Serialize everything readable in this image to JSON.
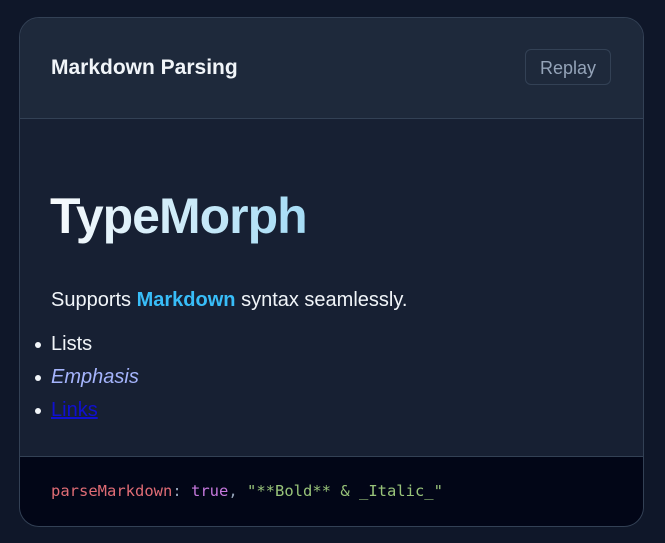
{
  "header": {
    "title": "Markdown Parsing",
    "replay_label": "Replay"
  },
  "preview": {
    "heading": "TypeMorph",
    "paragraph": {
      "before": "Supports ",
      "bold": "Markdown",
      "after": " syntax seamlessly."
    },
    "list": [
      "Lists",
      "Emphasis",
      "Links"
    ]
  },
  "code": {
    "key": "parseMarkdown",
    "colon": ": ",
    "value": "true",
    "comma": ", ",
    "string": "\"**Bold** & _Italic_\""
  },
  "colors": {
    "accent": "#38bdf8",
    "emphasis": "#a5b4fc",
    "link": "#1010d0"
  }
}
